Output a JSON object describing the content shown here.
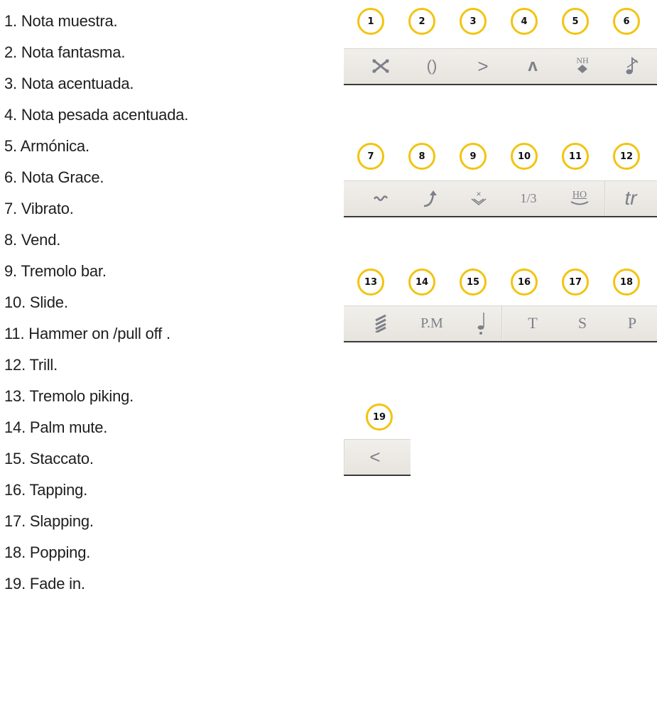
{
  "legend": [
    "1. Nota muestra.",
    "2. Nota fantasma.",
    "3. Nota acentuada.",
    "4. Nota pesada acentuada.",
    "5. Armónica.",
    "6. Nota Grace.",
    "7. Vibrato.",
    "8. Vend.",
    "9. Tremolo bar.",
    "10. Slide.",
    "11. Hammer on /pull off .",
    "12. Trill.",
    "13. Tremolo piking.",
    "14. Palm mute.",
    "15. Staccato.",
    "16. Tapping.",
    "17. Slapping.",
    "18. Popping.",
    "19. Fade in."
  ],
  "badges": [
    "1",
    "2",
    "3",
    "4",
    "5",
    "6",
    "7",
    "8",
    "9",
    "10",
    "11",
    "12",
    "13",
    "14",
    "15",
    "16",
    "17",
    "18",
    "19"
  ],
  "buttons": {
    "ghost": "()",
    "accent": ">",
    "heavy_accent": "ʌ",
    "harmonic": "NH",
    "slide": "1/3",
    "hammer": "HO",
    "trill": "tr",
    "palm_mute": "P.M",
    "tapping": "T",
    "slapping": "S",
    "popping": "P",
    "fade_in": "<"
  },
  "colors": {
    "badge_border": "#f2c40f",
    "icon_gray": "#7d8089",
    "toolbar_bg": "#ece9e4"
  }
}
